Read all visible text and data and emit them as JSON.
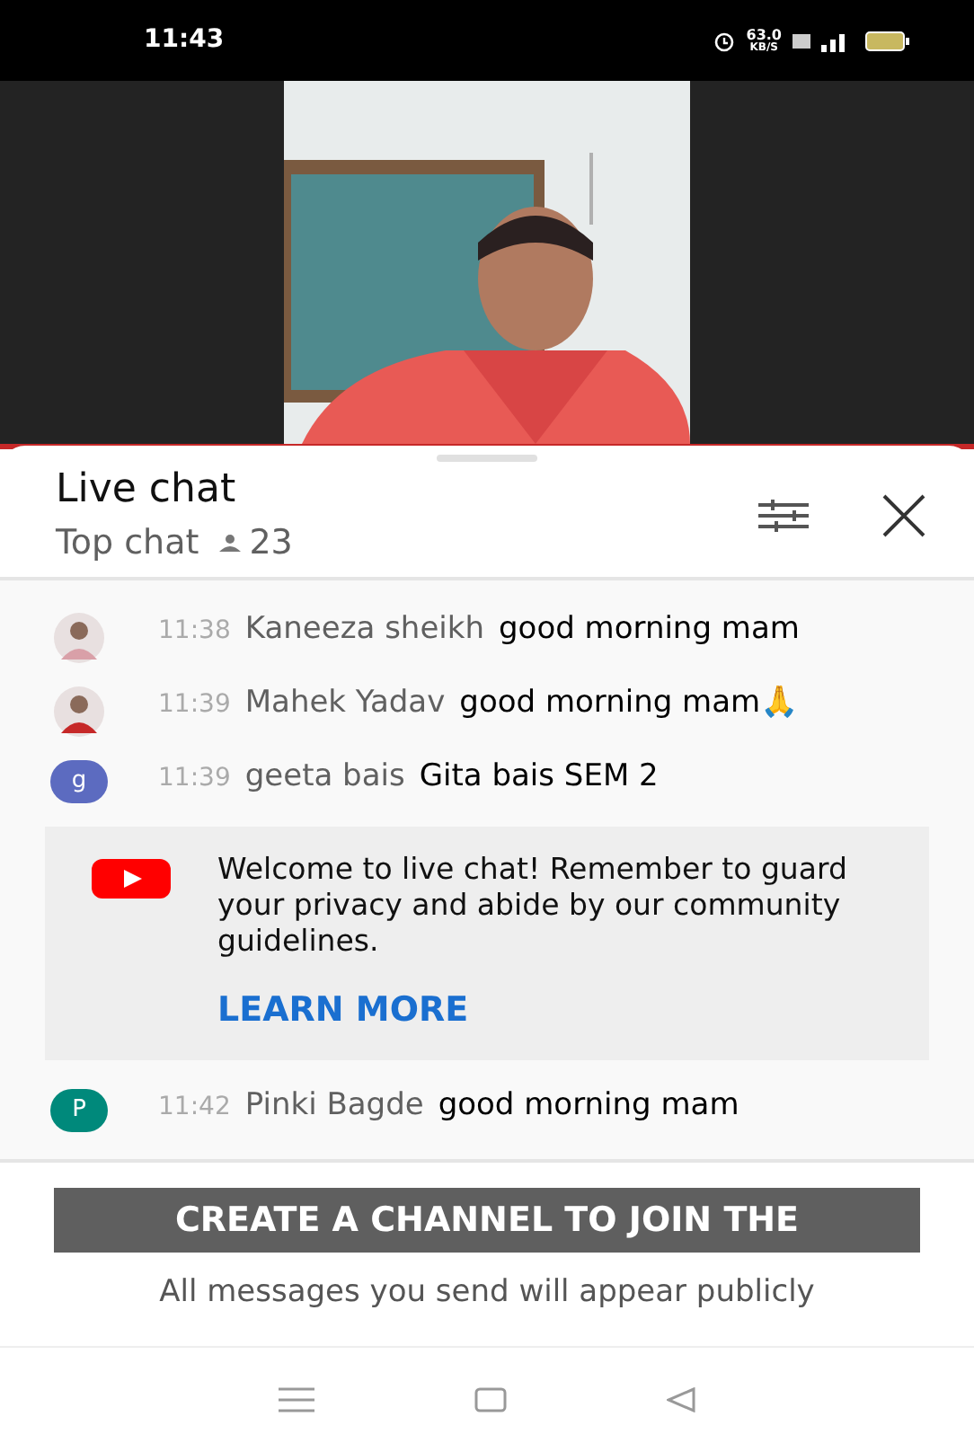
{
  "status_bar": {
    "time": "11:43",
    "network_speed": "63.0",
    "network_unit": "KB/S"
  },
  "chat": {
    "title": "Live chat",
    "mode": "Top chat",
    "viewer_count": "23"
  },
  "messages_before": [
    {
      "color": "#d9a0a8",
      "time": "11:38",
      "author": "Kaneeza sheikh",
      "text": "good morning mam"
    },
    {
      "color": "#c62828",
      "time": "11:39",
      "author": "Mahek Yadav",
      "text": "good morning mam🙏"
    },
    {
      "kind": "letter",
      "avatar_letter": "g",
      "color": "#5c6bc0",
      "time": "11:39",
      "author": "geeta bais",
      "text": "Gita bais SEM 2"
    }
  ],
  "notice": {
    "text": "Welcome to live chat! Remember to guard your privacy and abide by our community guidelines.",
    "link": "LEARN MORE"
  },
  "messages_after": [
    {
      "kind": "letter",
      "avatar_letter": "P",
      "color": "#00897b",
      "time": "11:42",
      "author": "Pinki Bagde",
      "text": "good morning mam"
    }
  ],
  "join_button": "CREATE A CHANNEL TO JOIN THE",
  "footer_note": "All messages you send will appear publicly"
}
